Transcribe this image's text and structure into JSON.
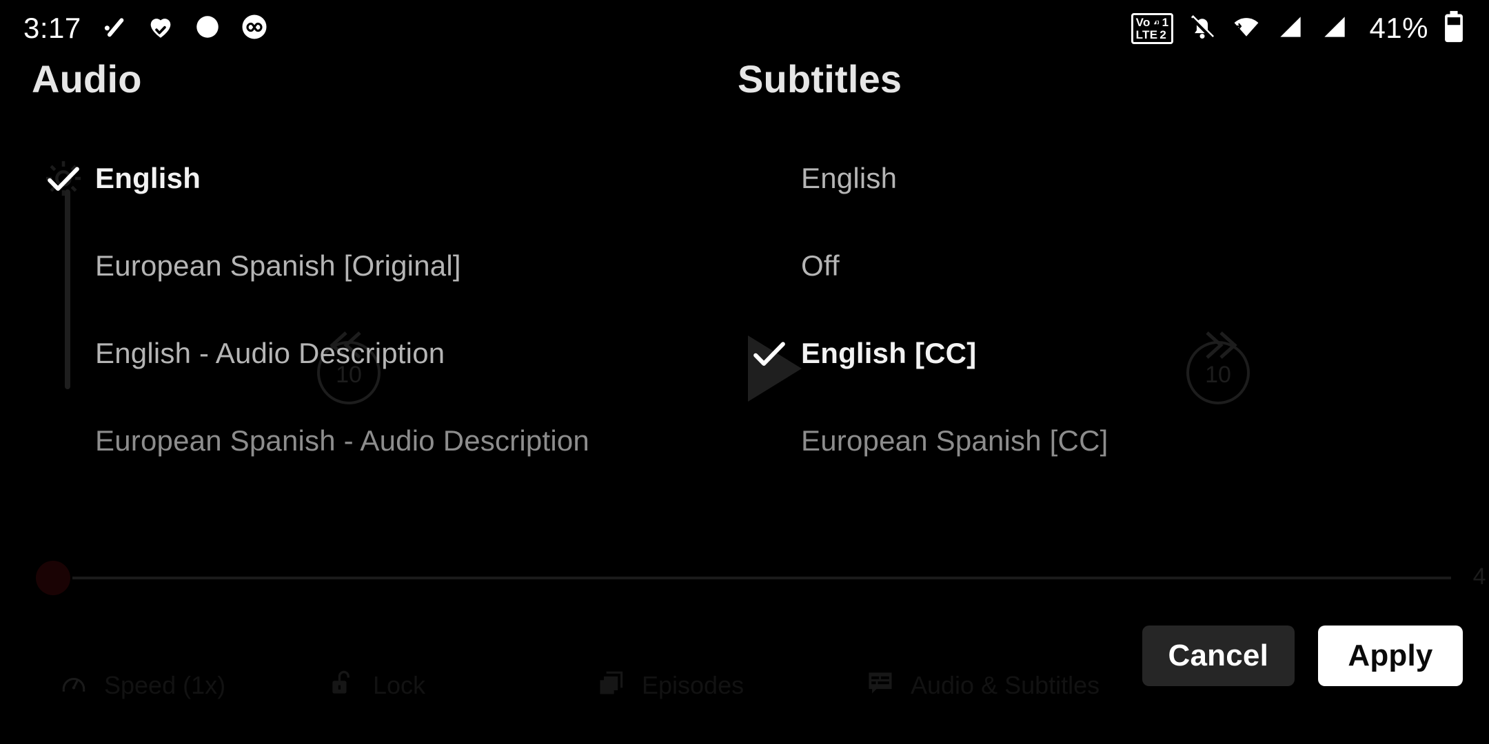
{
  "status_bar": {
    "clock": "3:17",
    "icons_left": [
      "check-activity-icon",
      "heart-health-icon",
      "circle-dot-icon",
      "infinity-loop-icon"
    ],
    "network": {
      "voice_label": "Vo",
      "voice_sim": "1",
      "data_label": "LTE",
      "data_sim": "2"
    },
    "icons_right": [
      "volte-dual-sim-icon",
      "notifications-muted-icon",
      "wifi-icon",
      "signal-sim1-icon",
      "signal-sim2-icon"
    ],
    "battery_percent": "41%",
    "battery_icon": "battery-icon"
  },
  "panel": {
    "audio": {
      "title": "Audio",
      "options": [
        {
          "label": "English",
          "selected": true,
          "dim": false
        },
        {
          "label": "European Spanish [Original]",
          "selected": false,
          "dim": false
        },
        {
          "label": "English - Audio Description",
          "selected": false,
          "dim": false
        },
        {
          "label": "European Spanish - Audio Description",
          "selected": false,
          "dim": true
        }
      ]
    },
    "subtitles": {
      "title": "Subtitles",
      "options": [
        {
          "label": "English",
          "selected": false,
          "dim": false
        },
        {
          "label": "Off",
          "selected": false,
          "dim": false
        },
        {
          "label": "English [CC]",
          "selected": true,
          "dim": false
        },
        {
          "label": "European Spanish [CC]",
          "selected": false,
          "dim": true
        }
      ]
    }
  },
  "actions": {
    "cancel_label": "Cancel",
    "apply_label": "Apply"
  },
  "player": {
    "skip_back_seconds": "10",
    "skip_forward_seconds": "10",
    "time_remaining": "4",
    "controls": [
      {
        "label": "Speed (1x)",
        "icon": "speedometer-icon"
      },
      {
        "label": "Lock",
        "icon": "unlock-padlock-icon"
      },
      {
        "label": "Episodes",
        "icon": "episodes-stack-icon"
      },
      {
        "label": "Audio & Subtitles",
        "icon": "audio-subtitles-icon"
      }
    ]
  },
  "colors": {
    "background": "#000000",
    "title_text": "#e6e6e6",
    "option_text": "#b5b5b5",
    "selected_text": "#f2f2f2",
    "cancel_bg": "#262626",
    "apply_bg": "#ffffff",
    "ghost_chrome": "#1f1f1f",
    "scrub_knob": "#1a0304"
  }
}
